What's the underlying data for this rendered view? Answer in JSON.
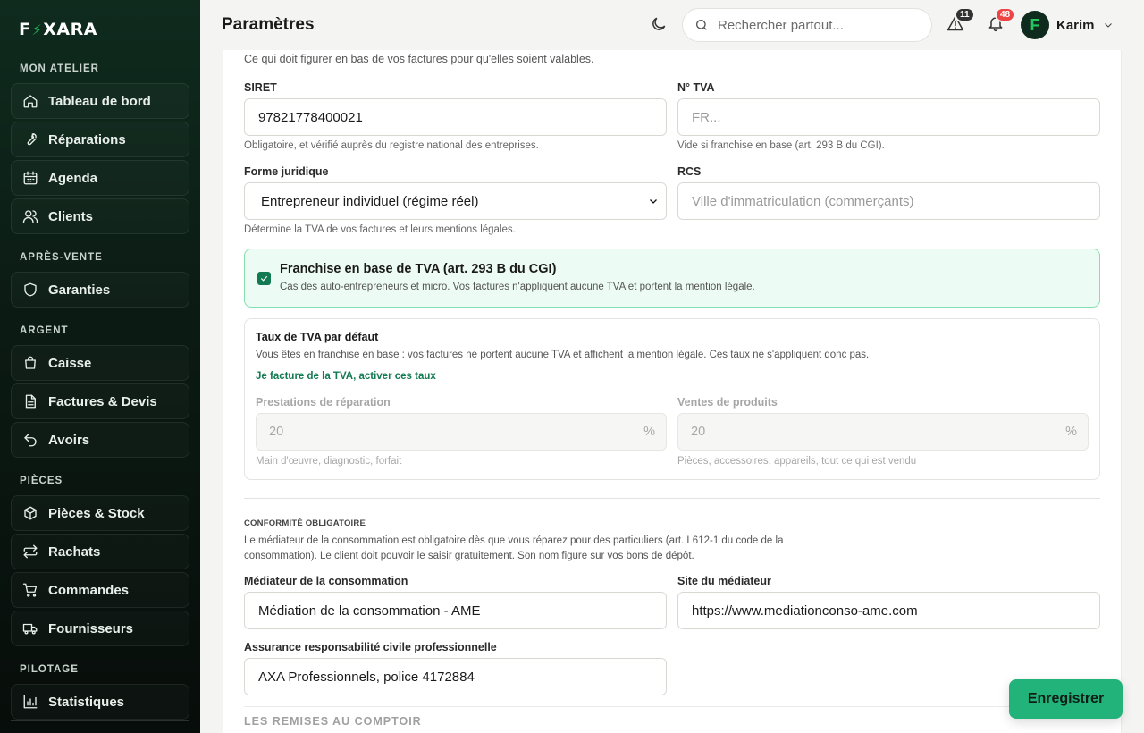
{
  "app": {
    "logo_left": "F",
    "logo_right": "XARA"
  },
  "sidebar": {
    "sections": [
      {
        "title": "MON ATELIER",
        "items": [
          {
            "label": "Tableau de bord",
            "icon": "home-icon"
          },
          {
            "label": "Réparations",
            "icon": "wrench-icon"
          },
          {
            "label": "Agenda",
            "icon": "calendar-icon"
          },
          {
            "label": "Clients",
            "icon": "users-icon"
          }
        ]
      },
      {
        "title": "APRÈS-VENTE",
        "items": [
          {
            "label": "Garanties",
            "icon": "shield-icon"
          }
        ]
      },
      {
        "title": "ARGENT",
        "items": [
          {
            "label": "Caisse",
            "icon": "register-icon"
          },
          {
            "label": "Factures & Devis",
            "icon": "document-icon"
          },
          {
            "label": "Avoirs",
            "icon": "undo-icon"
          }
        ]
      },
      {
        "title": "PIÈCES",
        "items": [
          {
            "label": "Pièces & Stock",
            "icon": "box-icon"
          },
          {
            "label": "Rachats",
            "icon": "swap-icon"
          },
          {
            "label": "Commandes",
            "icon": "cart-icon"
          },
          {
            "label": "Fournisseurs",
            "icon": "truck-icon"
          }
        ]
      },
      {
        "title": "PILOTAGE",
        "items": [
          {
            "label": "Statistiques",
            "icon": "chart-icon"
          }
        ]
      }
    ]
  },
  "header": {
    "title": "Paramètres",
    "search_placeholder": "Rechercher partout...",
    "alerts_count": "11",
    "notifications_count": "48",
    "user_initial": "F",
    "user_name": "Karim"
  },
  "form": {
    "intro": "Ce qui doit figurer en bas de vos factures pour qu'elles soient valables.",
    "siret": {
      "label": "SIRET",
      "value": "97821778400021",
      "help": "Obligatoire, et vérifié auprès du registre national des entreprises."
    },
    "tva_number": {
      "label": "N° TVA",
      "placeholder": "FR...",
      "help": "Vide si franchise en base (art. 293 B du CGI)."
    },
    "forme": {
      "label": "Forme juridique",
      "value": "Entrepreneur individuel (régime réel)",
      "help": "Détermine la TVA de vos factures et leurs mentions légales."
    },
    "rcs": {
      "label": "RCS",
      "placeholder": "Ville d'immatriculation (commerçants)"
    },
    "franchise": {
      "title": "Franchise en base de TVA (art. 293 B du CGI)",
      "desc": "Cas des auto-entrepreneurs et micro. Vos factures n'appliquent aucune TVA et portent la mention légale.",
      "checked": true
    },
    "tva_rates": {
      "title": "Taux de TVA par défaut",
      "desc": "Vous êtes en franchise en base : vos factures ne portent aucune TVA et affichent la mention légale. Ces taux ne s'appliquent donc pas.",
      "link": "Je facture de la TVA, activer ces taux",
      "services": {
        "label": "Prestations de réparation",
        "value": "20",
        "unit": "%",
        "help": "Main d'œuvre, diagnostic, forfait"
      },
      "products": {
        "label": "Ventes de produits",
        "value": "20",
        "unit": "%",
        "help": "Pièces, accessoires, appareils, tout ce qui est vendu"
      }
    },
    "compliance": {
      "caption": "CONFORMITÉ OBLIGATOIRE",
      "desc": "Le médiateur de la consommation est obligatoire dès que vous réparez pour des particuliers (art. L612-1 du code de la consommation). Le client doit pouvoir le saisir gratuitement. Son nom figure sur vos bons de dépôt.",
      "mediator": {
        "label": "Médiateur de la consommation",
        "value": "Médiation de la consommation - AME"
      },
      "mediator_site": {
        "label": "Site du médiateur",
        "value": "https://www.mediationconso-ame.com"
      },
      "insurance": {
        "label": "Assurance responsabilité civile professionnelle",
        "value": "AXA Professionnels, police 4172884"
      }
    },
    "next_section": "LES REMISES AU COMPTOIR"
  },
  "actions": {
    "save": "Enregistrer"
  },
  "colors": {
    "accent": "#22b37a",
    "brand_dark": "#0f2b1e",
    "link": "#127a52",
    "badge_red": "#ef4444"
  }
}
